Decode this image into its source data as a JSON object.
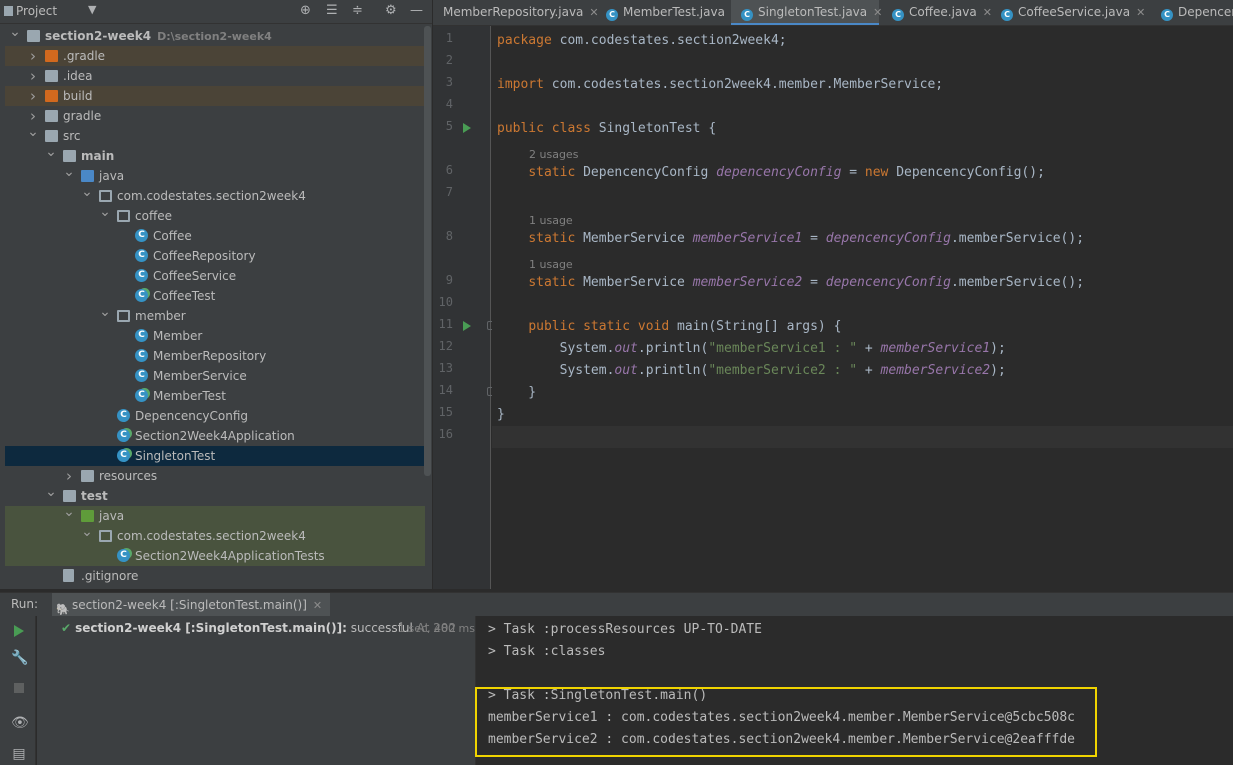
{
  "project_panel": {
    "title": "Project",
    "icons": [
      "target-icon",
      "expand-all-icon",
      "collapse-all-icon",
      "gear-icon",
      "minimize-icon"
    ]
  },
  "tree": [
    {
      "label": "section2-week4",
      "hint": "D:\\section2-week4",
      "depth": 0,
      "expanded": true,
      "icon": "module",
      "bold": true
    },
    {
      "label": ".gradle",
      "depth": 1,
      "expanded": false,
      "icon": "folder-orange",
      "style": "excluded"
    },
    {
      "label": ".idea",
      "depth": 1,
      "expanded": false,
      "icon": "folder-gray"
    },
    {
      "label": "build",
      "depth": 1,
      "expanded": false,
      "icon": "folder-orange",
      "style": "excluded"
    },
    {
      "label": "gradle",
      "depth": 1,
      "expanded": false,
      "icon": "folder-gray"
    },
    {
      "label": "src",
      "depth": 1,
      "expanded": true,
      "icon": "folder-gray"
    },
    {
      "label": "main",
      "depth": 2,
      "expanded": true,
      "icon": "module",
      "bold": true
    },
    {
      "label": "java",
      "depth": 3,
      "expanded": true,
      "icon": "folder-blue"
    },
    {
      "label": "com.codestates.section2week4",
      "depth": 4,
      "expanded": true,
      "icon": "package"
    },
    {
      "label": "coffee",
      "depth": 5,
      "expanded": true,
      "icon": "package"
    },
    {
      "label": "Coffee",
      "depth": 6,
      "icon": "cls"
    },
    {
      "label": "CoffeeRepository",
      "depth": 6,
      "icon": "cls"
    },
    {
      "label": "CoffeeService",
      "depth": 6,
      "icon": "cls"
    },
    {
      "label": "CoffeeTest",
      "depth": 6,
      "icon": "testcls"
    },
    {
      "label": "member",
      "depth": 5,
      "expanded": true,
      "icon": "package"
    },
    {
      "label": "Member",
      "depth": 6,
      "icon": "cls"
    },
    {
      "label": "MemberRepository",
      "depth": 6,
      "icon": "cls"
    },
    {
      "label": "MemberService",
      "depth": 6,
      "icon": "cls"
    },
    {
      "label": "MemberTest",
      "depth": 6,
      "icon": "testcls"
    },
    {
      "label": "DepencencyConfig",
      "depth": 5,
      "icon": "cls"
    },
    {
      "label": "Section2Week4Application",
      "depth": 5,
      "icon": "testcls"
    },
    {
      "label": "SingletonTest",
      "depth": 5,
      "icon": "testcls",
      "style": "selected"
    },
    {
      "label": "resources",
      "depth": 3,
      "expanded": false,
      "icon": "resources"
    },
    {
      "label": "test",
      "depth": 2,
      "expanded": true,
      "icon": "module",
      "bold": true
    },
    {
      "label": "java",
      "depth": 3,
      "expanded": true,
      "icon": "folder-green",
      "style": "testsrc"
    },
    {
      "label": "com.codestates.section2week4",
      "depth": 4,
      "expanded": true,
      "icon": "package",
      "style": "testsrc"
    },
    {
      "label": "Section2Week4ApplicationTests",
      "depth": 5,
      "icon": "testcls",
      "style": "testsrc"
    },
    {
      "label": ".gitignore",
      "depth": 2,
      "icon": "file"
    }
  ],
  "tabs": [
    {
      "label": "MemberRepository.java",
      "icon": "none",
      "active": false
    },
    {
      "label": "MemberTest.java",
      "icon": "test-class-icon",
      "active": false
    },
    {
      "label": "SingletonTest.java",
      "icon": "test-class-icon",
      "active": true
    },
    {
      "label": "Coffee.java",
      "icon": "class-icon",
      "active": false
    },
    {
      "label": "CoffeeService.java",
      "icon": "class-icon",
      "active": false
    },
    {
      "label": "DepencencyC",
      "icon": "class-icon",
      "active": false
    }
  ],
  "code_lines": [
    {
      "n": "1",
      "parts": [
        [
          "kw",
          "package "
        ],
        [
          "",
          "com.codestates.section2week4;"
        ]
      ]
    },
    {
      "n": "2",
      "parts": []
    },
    {
      "n": "3",
      "parts": [
        [
          "kw",
          "import "
        ],
        [
          "",
          "com.codestates.section2week4.member.MemberService;"
        ]
      ]
    },
    {
      "n": "4",
      "parts": []
    },
    {
      "n": "5",
      "run": true,
      "parts": [
        [
          "kw",
          "public class "
        ],
        [
          "",
          "SingletonTest {"
        ]
      ]
    },
    {
      "hint": "2 usages"
    },
    {
      "n": "6",
      "parts": [
        [
          "",
          "    "
        ],
        [
          "kw",
          "static "
        ],
        [
          "",
          "DepencencyConfig "
        ],
        [
          "sf",
          "depencencyConfig"
        ],
        [
          "",
          " = "
        ],
        [
          "kw",
          "new "
        ],
        [
          "",
          "DepencencyConfig();"
        ]
      ]
    },
    {
      "n": "7",
      "parts": []
    },
    {
      "hint": "1 usage"
    },
    {
      "n": "8",
      "parts": [
        [
          "",
          "    "
        ],
        [
          "kw",
          "static "
        ],
        [
          "",
          "MemberService "
        ],
        [
          "sf",
          "memberService1"
        ],
        [
          "",
          " = "
        ],
        [
          "sf",
          "depencencyConfig"
        ],
        [
          "",
          ".memberService();"
        ]
      ]
    },
    {
      "hint": "1 usage"
    },
    {
      "n": "9",
      "parts": [
        [
          "",
          "    "
        ],
        [
          "kw",
          "static "
        ],
        [
          "",
          "MemberService "
        ],
        [
          "sf",
          "memberService2"
        ],
        [
          "",
          " = "
        ],
        [
          "sf",
          "depencencyConfig"
        ],
        [
          "",
          ".memberService();"
        ]
      ]
    },
    {
      "n": "10",
      "parts": []
    },
    {
      "n": "11",
      "run": true,
      "fold": true,
      "parts": [
        [
          "",
          "    "
        ],
        [
          "kw",
          "public static void "
        ],
        [
          "",
          "main(String[] args) {"
        ]
      ]
    },
    {
      "n": "12",
      "parts": [
        [
          "",
          "        System."
        ],
        [
          "sf",
          "out"
        ],
        [
          "",
          ".println("
        ],
        [
          "str",
          "\"memberService1 : \""
        ],
        [
          "",
          " + "
        ],
        [
          "sf",
          "memberService1"
        ],
        [
          "",
          ");"
        ]
      ]
    },
    {
      "n": "13",
      "parts": [
        [
          "",
          "        System."
        ],
        [
          "sf",
          "out"
        ],
        [
          "",
          ".println("
        ],
        [
          "str",
          "\"memberService2 : \""
        ],
        [
          "",
          " + "
        ],
        [
          "sf",
          "memberService2"
        ],
        [
          "",
          ");"
        ]
      ]
    },
    {
      "n": "14",
      "fold": true,
      "parts": [
        [
          "",
          "    }"
        ]
      ]
    },
    {
      "n": "15",
      "parts": [
        [
          "",
          "}"
        ]
      ]
    },
    {
      "n": "16",
      "current": true,
      "parts": []
    }
  ],
  "run_panel": {
    "label": "Run:",
    "tab_label": "section2-week4 [:SingletonTest.main()]",
    "item_name": "section2-week4 [:SingletonTest.main()]:",
    "item_status": " successful",
    "item_at": " At 202",
    "item_time": "1 sec, 480 ms"
  },
  "console_lines": [
    "> Task :processResources UP-TO-DATE",
    "> Task :classes",
    "",
    "> Task :SingletonTest.main()",
    "memberService1 : com.codestates.section2week4.member.MemberService@5cbc508c",
    "memberService2 : com.codestates.section2week4.member.MemberService@2eafffde"
  ],
  "colors": {
    "highlight_box": "#f0d400",
    "keyword": "#cc7832",
    "static_field": "#9876aa",
    "string": "#6a8759"
  }
}
